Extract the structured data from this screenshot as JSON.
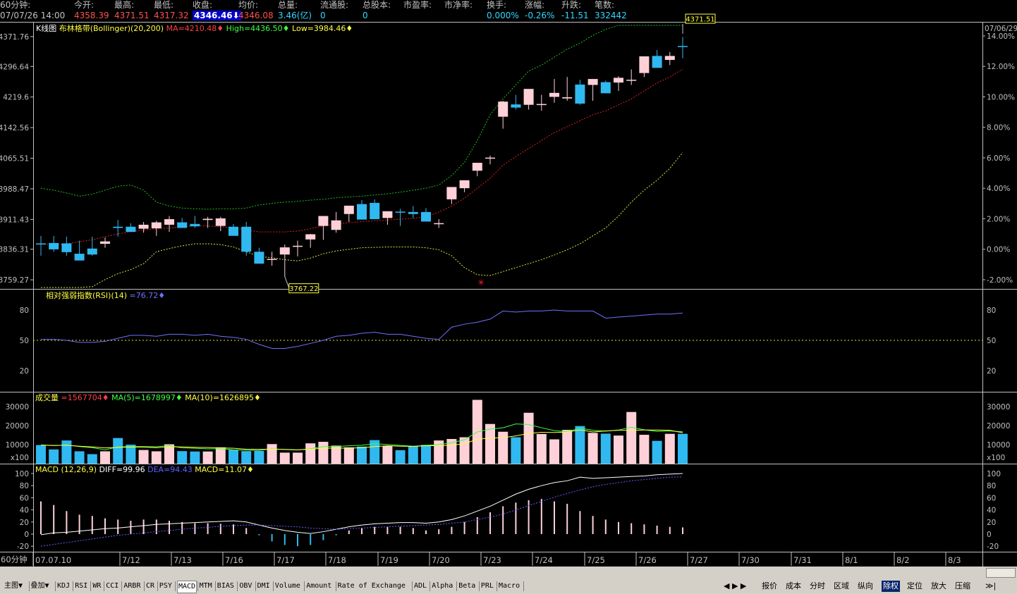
{
  "header": {
    "labels": [
      "60分钟:",
      "今开:",
      "最高:",
      "最低:",
      "收盘:",
      "均价:",
      "总量:",
      "流通股:",
      "总股本:",
      "市盈率:",
      "市净率:",
      "换手:",
      "涨幅:",
      "升跌:",
      "笔数:"
    ],
    "date": "07/07/26",
    "time": "14:00",
    "open": "4358.39",
    "high": "4371.51",
    "low": "4317.32",
    "close": "4346.46",
    "avg": "4346.08",
    "volume": "3.46(亿)",
    "float_shares": "0",
    "total_shares": "0",
    "pe": "",
    "pb": "",
    "turnover": "0.000%",
    "change_pct": "-0.26%",
    "change": "-11.51",
    "trades": "332442",
    "close_arrow": "down-arrow-icon"
  },
  "main_panel": {
    "title": "K线图",
    "indicator": "布林格带(Bollinger)(20,200)",
    "ma": "MA=4210.48",
    "high": "High=4436.50",
    "low": "Low=3984.46",
    "corner_date": "07/06/29",
    "left_ticks": [
      "4371.76",
      "4296.64",
      "4219.6",
      "4142.56",
      "4065.51",
      "3988.47",
      "3911.43",
      "3836.31",
      "3759.27"
    ],
    "right_ticks": [
      "14.00%",
      "12.00%",
      "10.00%",
      "8.00%",
      "6.00%",
      "4.00%",
      "2.00%",
      "0.00%",
      "-2.00%"
    ],
    "high_tag": "4371.51",
    "low_tag": "3767.22"
  },
  "rsi_panel": {
    "title": "相对强弱指数(RSI)(14)",
    "value": "=76.72",
    "ticks": [
      "80",
      "50",
      "20"
    ]
  },
  "vol_panel": {
    "title": "成交量",
    "value": "=1567704",
    "ma5": "MA(5)=1678997",
    "ma10": "MA(10)=1626895",
    "ticks": [
      "30000",
      "20000",
      "10000",
      "x100"
    ]
  },
  "macd_panel": {
    "title": "MACD",
    "params": "(12,26,9)",
    "diff": "DIFF=99.96",
    "dea": "DEA=94.43",
    "macd": "MACD=11.07",
    "ticks": [
      "100",
      "80",
      "60",
      "40",
      "20",
      "0",
      "-20"
    ]
  },
  "x_axis": {
    "period_label": "60分钟",
    "labels": [
      "07.07.10",
      "7/12",
      "7/13",
      "7/16",
      "7/17",
      "7/18",
      "7/19",
      "7/20",
      "7/23",
      "7/24",
      "7/25",
      "7/26",
      "7/27",
      "7/30",
      "7/31",
      "8/1",
      "8/2",
      "8/3"
    ]
  },
  "tabs": {
    "left": [
      "主图",
      "叠加",
      "KDJ",
      "RSI",
      "WR",
      "CCI",
      "ARBR",
      "CR",
      "PSY",
      "MACD",
      "MTM",
      "BIAS",
      "OBV",
      "DMI",
      "Volume",
      "Amount",
      "Rate of Exchange",
      "ADL",
      "Alpha",
      "Beta",
      "PRL",
      "Macro"
    ],
    "selected": "MACD",
    "right": [
      "报价",
      "成本",
      "分时",
      "区域",
      "纵向",
      "除权",
      "定位",
      "放大",
      "压缩"
    ],
    "right_selected": "除权"
  },
  "colors": {
    "up": "#ffd0d8",
    "down": "#30b8f0",
    "bb_upper": "#20c020",
    "bb_mid": "#e02020",
    "bb_lower": "#e0e040",
    "rsi": "#7070ff",
    "grid": "#c00000",
    "axis": "#c0c0c0"
  },
  "chart_data": [
    {
      "type": "candlestick",
      "title": "K线图",
      "x": [
        "07/10-1",
        "07/10-2",
        "07/10-3",
        "07/10-4",
        "07/11-1",
        "07/11-2",
        "07/11-3",
        "07/11-4",
        "07/12-1",
        "07/12-2",
        "07/12-3",
        "07/12-4",
        "07/13-1",
        "07/13-2",
        "07/13-3",
        "07/13-4",
        "07/16-1",
        "07/16-2",
        "07/16-3",
        "07/16-4",
        "07/17-1",
        "07/17-2",
        "07/17-3",
        "07/17-4",
        "07/18-1",
        "07/18-2",
        "07/18-3",
        "07/18-4",
        "07/19-1",
        "07/19-2",
        "07/19-3",
        "07/19-4",
        "07/20-1",
        "07/20-2",
        "07/20-3",
        "07/20-4",
        "07/23-1",
        "07/23-2",
        "07/23-3",
        "07/23-4",
        "07/24-1",
        "07/24-2",
        "07/24-3",
        "07/24-4",
        "07/25-1",
        "07/25-2",
        "07/25-3",
        "07/25-4",
        "07/26-1",
        "07/26-2",
        "07/26-3"
      ],
      "open": [
        3851,
        3852,
        3851,
        3825,
        3838,
        3850,
        3893,
        3893,
        3888,
        3889,
        3898,
        3904,
        3900,
        3910,
        3895,
        3893,
        3893,
        3830,
        3812,
        3823,
        3845,
        3861,
        3895,
        3885,
        3925,
        3950,
        3953,
        3915,
        3931,
        3930,
        3930,
        3900,
        3962,
        3990,
        4034,
        4065,
        4170,
        4201,
        4200,
        4202,
        4220,
        4216,
        4251,
        4250,
        4257,
        4256,
        4262,
        4280,
        4323,
        4313,
        4348
      ],
      "high": [
        3870,
        3870,
        3868,
        3858,
        3868,
        3866,
        3910,
        3902,
        3905,
        3908,
        3920,
        3915,
        3920,
        3918,
        3918,
        3900,
        3905,
        3840,
        3830,
        3848,
        3858,
        3875,
        3910,
        3930,
        3935,
        3960,
        3962,
        3925,
        3938,
        3945,
        3940,
        3912,
        3975,
        4006,
        4045,
        4072,
        4210,
        4225,
        4226,
        4225,
        4265,
        4270,
        4263,
        4260,
        4261,
        4272,
        4289,
        4305,
        4338,
        4333,
        4371
      ],
      "low": [
        3820,
        3830,
        3820,
        3810,
        3820,
        3840,
        3868,
        3880,
        3878,
        3870,
        3880,
        3895,
        3890,
        3890,
        3882,
        3870,
        3820,
        3800,
        3795,
        3767,
        3818,
        3840,
        3860,
        3878,
        3905,
        3920,
        3920,
        3898,
        3895,
        3915,
        3912,
        3890,
        3950,
        3980,
        4020,
        4050,
        4140,
        4188,
        4188,
        4185,
        4205,
        4210,
        4200,
        4210,
        4230,
        4235,
        4250,
        4270,
        4295,
        4300,
        4317
      ],
      "close": [
        3850,
        3836,
        3829,
        3808,
        3823,
        3856,
        3890,
        3880,
        3898,
        3904,
        3912,
        3890,
        3894,
        3913,
        3914,
        3870,
        3830,
        3800,
        3812,
        3841,
        3845,
        3874,
        3920,
        3909,
        3946,
        3911,
        3912,
        3932,
        3930,
        3925,
        3906,
        3902,
        3993,
        4010,
        4054,
        4067,
        4208,
        4193,
        4240,
        4202,
        4230,
        4219,
        4203,
        4265,
        4229,
        4268,
        4263,
        4322,
        4293,
        4323,
        4346
      ],
      "bollinger": {
        "upper": [
          3990,
          3985,
          3978,
          3970,
          3975,
          3985,
          3995,
          3998,
          3985,
          3955,
          3945,
          3940,
          3938,
          3937,
          3938,
          3938,
          3940,
          3948,
          3952,
          3955,
          3957,
          3960,
          3962,
          3966,
          3968,
          3970,
          3973,
          3976,
          3980,
          3985,
          3990,
          3998,
          4022,
          4055,
          4110,
          4175,
          4215,
          4250,
          4285,
          4300,
          4320,
          4340,
          4355,
          4375,
          4390,
          4408,
          4425,
          4440,
          4458,
          4470,
          4475
        ],
        "mid": [
          3850,
          3848,
          3850,
          3855,
          3860,
          3868,
          3875,
          3880,
          3885,
          3888,
          3890,
          3893,
          3895,
          3895,
          3893,
          3890,
          3885,
          3880,
          3880,
          3880,
          3882,
          3888,
          3895,
          3900,
          3903,
          3906,
          3908,
          3910,
          3912,
          3914,
          3918,
          3930,
          3945,
          3965,
          3990,
          4015,
          4048,
          4070,
          4090,
          4110,
          4130,
          4145,
          4160,
          4175,
          4185,
          4200,
          4215,
          4235,
          4255,
          4270,
          4290
        ],
        "lower": [
          3720,
          3718,
          3722,
          3730,
          3742,
          3760,
          3775,
          3785,
          3800,
          3830,
          3838,
          3845,
          3850,
          3850,
          3848,
          3842,
          3830,
          3818,
          3815,
          3810,
          3807,
          3814,
          3825,
          3832,
          3836,
          3840,
          3841,
          3842,
          3842,
          3842,
          3840,
          3835,
          3820,
          3790,
          3772,
          3770,
          3780,
          3790,
          3800,
          3810,
          3822,
          3835,
          3850,
          3870,
          3890,
          3920,
          3955,
          3985,
          4010,
          4040,
          4080
        ]
      },
      "ylim": [
        3740,
        4400
      ],
      "annotations": [
        "4371.51",
        "3767.22"
      ]
    },
    {
      "type": "line",
      "title": "相对强弱指数(RSI)(14)",
      "series": [
        {
          "name": "RSI",
          "values": [
            51,
            51,
            50,
            48,
            48,
            49,
            52,
            55,
            55,
            54,
            56,
            56,
            55,
            56,
            54,
            53,
            51,
            46,
            42,
            42,
            44,
            47,
            50,
            54,
            55,
            57,
            58,
            56,
            56,
            54,
            52,
            51,
            63,
            66,
            68,
            71,
            79,
            78,
            79,
            79,
            80,
            79,
            79,
            79,
            72,
            73,
            74,
            75,
            76,
            76,
            77
          ]
        }
      ],
      "ylim": [
        0,
        100
      ]
    },
    {
      "type": "bar",
      "title": "成交量",
      "series": [
        {
          "name": "成交量",
          "values": [
            9800,
            7500,
            12200,
            6500,
            5000,
            6500,
            13500,
            10000,
            7200,
            6500,
            10200,
            6600,
            6400,
            6400,
            8600,
            7400,
            6600,
            6700,
            10300,
            5800,
            5800,
            10700,
            11500,
            9500,
            8600,
            9000,
            12400,
            9300,
            7100,
            9100,
            9900,
            12200,
            13000,
            13900,
            33600,
            20900,
            16800,
            13900,
            26800,
            15600,
            12800,
            17800,
            19800,
            16200,
            15800,
            14800,
            27200,
            15200,
            12000,
            15700,
            15700
          ]
        },
        {
          "name": "MA(5)",
          "values": [
            9800,
            9500,
            9800,
            9000,
            8400,
            7300,
            8800,
            9000,
            9000,
            8900,
            9500,
            8300,
            8100,
            7800,
            7900,
            7300,
            7100,
            7000,
            7800,
            7400,
            7200,
            7900,
            9000,
            9000,
            9400,
            9700,
            10500,
            10100,
            9600,
            9200,
            9600,
            10000,
            11000,
            12600,
            16700,
            18200,
            18900,
            20900,
            20600,
            18900,
            17400,
            16800,
            18700,
            17600,
            17100,
            17700,
            19200,
            17800,
            17000,
            17200,
            16800
          ]
        },
        {
          "name": "MA(10)",
          "values": [
            9800,
            9600,
            9700,
            9200,
            8800,
            8300,
            8600,
            8700,
            8700,
            8400,
            8900,
            8800,
            8600,
            8500,
            8300,
            8100,
            7600,
            7500,
            7600,
            7500,
            7300,
            7600,
            8100,
            8200,
            8100,
            8400,
            9000,
            9400,
            9200,
            9100,
            9400,
            9500,
            9700,
            10500,
            12900,
            13400,
            13700,
            14600,
            15900,
            16500,
            16400,
            16600,
            17800,
            16700,
            17200,
            17600,
            17600,
            17700,
            17700,
            17600,
            16300
          ]
        }
      ],
      "ylim": [
        0,
        34000
      ]
    },
    {
      "type": "bar",
      "title": "MACD",
      "series": [
        {
          "name": "DIFF",
          "values": [
            -1,
            2,
            3,
            5,
            7,
            9,
            10,
            12,
            14,
            16,
            17,
            18,
            19,
            20,
            21,
            22,
            20,
            15,
            10,
            6,
            3,
            1,
            4,
            8,
            12,
            15,
            17,
            18,
            19,
            19,
            18,
            20,
            24,
            30,
            38,
            46,
            56,
            66,
            74,
            80,
            85,
            88,
            94,
            92,
            93,
            94,
            95,
            96,
            98,
            99,
            99.96
          ]
        },
        {
          "name": "DEA",
          "values": [
            -20,
            -17,
            -14,
            -11,
            -8,
            -5,
            -2,
            0,
            2,
            4,
            6,
            8,
            10,
            11,
            13,
            14,
            15,
            15,
            14,
            13,
            12,
            10,
            9,
            8,
            9,
            10,
            11,
            12,
            13,
            14,
            15,
            16,
            18,
            20,
            24,
            28,
            33,
            40,
            47,
            54,
            61,
            67,
            73,
            78,
            82,
            85,
            88,
            90,
            92,
            94,
            94.43
          ]
        },
        {
          "name": "MACD",
          "values": [
            54,
            48,
            38,
            32,
            30,
            26,
            24,
            22,
            24,
            24,
            22,
            20,
            18,
            18,
            17,
            16,
            10,
            -2,
            -12,
            -18,
            -20,
            -18,
            -10,
            -2,
            6,
            10,
            12,
            12,
            12,
            10,
            6,
            8,
            12,
            20,
            28,
            36,
            46,
            52,
            56,
            58,
            54,
            50,
            38,
            30,
            24,
            20,
            18,
            16,
            14,
            12,
            11.07
          ]
        }
      ],
      "ylim": [
        -25,
        105
      ]
    }
  ]
}
